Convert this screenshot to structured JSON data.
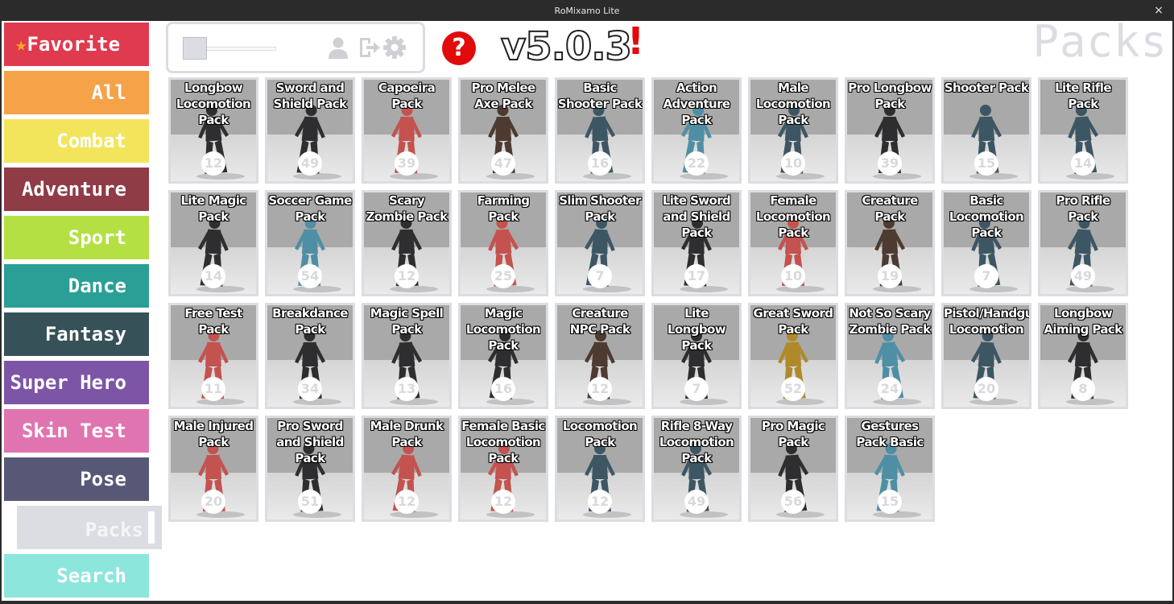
{
  "window": {
    "title": "RoMixamo Lite",
    "close_label": "×"
  },
  "categories": [
    {
      "label": "Favorite",
      "color": "#e03a4f",
      "star": "★"
    },
    {
      "label": "All",
      "color": "#f5a249"
    },
    {
      "label": "Combat",
      "color": "#f3e55b"
    },
    {
      "label": "Adventure",
      "color": "#8f3c47"
    },
    {
      "label": "Sport",
      "color": "#b4e043"
    },
    {
      "label": "Dance",
      "color": "#2a9f95"
    },
    {
      "label": "Fantasy",
      "color": "#365158"
    },
    {
      "label": "Super Hero",
      "color": "#7d55a6"
    },
    {
      "label": "Skin Test",
      "color": "#e074b0"
    },
    {
      "label": "Pose",
      "color": "#575876"
    },
    {
      "label": "Packs",
      "color": "#dcdde2",
      "selected": true
    },
    {
      "label": "Search",
      "color": "#8de6dc"
    }
  ],
  "controls": {
    "slider_value": 0.0,
    "icons": [
      "user-icon",
      "logout-icon",
      "gear-icon"
    ]
  },
  "help": {
    "label": "?"
  },
  "version": {
    "label": "v5.0.3"
  },
  "alert": {
    "label": "!"
  },
  "page_heading": "Packs",
  "colors": {
    "panel_border": "#dcdde2",
    "card_bg": "#a9a9a9",
    "help_red": "#e10b0b"
  },
  "packs": [
    {
      "title": "Longbow Locomotion Pack",
      "count": "12",
      "skin": "dark"
    },
    {
      "title": "Sword and Shield Pack",
      "count": "49",
      "skin": "dark"
    },
    {
      "title": "Capoeira Pack",
      "count": "39",
      "skin": "red"
    },
    {
      "title": "Pro Melee Axe Pack",
      "count": "47",
      "skin": "brown"
    },
    {
      "title": "Basic Shooter Pack",
      "count": "16",
      "skin": "blue"
    },
    {
      "title": "Action Adventure Pack",
      "count": "22",
      "skin": "teal"
    },
    {
      "title": "Male Locomotion Pack",
      "count": "10",
      "skin": "blue"
    },
    {
      "title": "Pro Longbow Pack",
      "count": "39",
      "skin": "dark"
    },
    {
      "title": "Shooter Pack",
      "count": "15",
      "skin": "blue"
    },
    {
      "title": "Lite Rifle Pack",
      "count": "14",
      "skin": "blue"
    },
    {
      "title": "Lite Magic Pack",
      "count": "14",
      "skin": "dark"
    },
    {
      "title": "Soccer Game Pack",
      "count": "54",
      "skin": "teal"
    },
    {
      "title": "Scary Zombie Pack",
      "count": "12",
      "skin": "dark"
    },
    {
      "title": "Farming Pack",
      "count": "25",
      "skin": "red"
    },
    {
      "title": "Slim Shooter Pack",
      "count": "7",
      "skin": "blue"
    },
    {
      "title": "Lite Sword and Shield Pack",
      "count": "17",
      "skin": "dark"
    },
    {
      "title": "Female Locomotion Pack",
      "count": "10",
      "skin": "red"
    },
    {
      "title": "Creature Pack",
      "count": "19",
      "skin": "brown"
    },
    {
      "title": "Basic Locomotion Pack",
      "count": "7",
      "skin": "blue"
    },
    {
      "title": "Pro Rifle Pack",
      "count": "49",
      "skin": "blue"
    },
    {
      "title": "Free Test Pack",
      "count": "11",
      "skin": "red"
    },
    {
      "title": "Breakdance Pack",
      "count": "34",
      "skin": "dark"
    },
    {
      "title": "Magic Spell Pack",
      "count": "13",
      "skin": "dark"
    },
    {
      "title": "Magic Locomotion Pack",
      "count": "16",
      "skin": "dark"
    },
    {
      "title": "Creature NPC Pack",
      "count": "12",
      "skin": "brown"
    },
    {
      "title": "Lite Longbow Pack",
      "count": "7",
      "skin": "dark"
    },
    {
      "title": "Great Sword Pack",
      "count": "52",
      "skin": "gold"
    },
    {
      "title": "Not So Scary Zombie Pack",
      "count": "24",
      "skin": "teal"
    },
    {
      "title": "Pistol/Handgun Locomotion",
      "count": "20",
      "skin": "blue"
    },
    {
      "title": "Longbow Aiming Pack",
      "count": "8",
      "skin": "dark"
    },
    {
      "title": "Male Injured Pack",
      "count": "20",
      "skin": "red"
    },
    {
      "title": "Pro Sword and Shield Pack",
      "count": "51",
      "skin": "dark"
    },
    {
      "title": "Male Drunk Pack",
      "count": "12",
      "skin": "red"
    },
    {
      "title": "Female Basic Locomotion Pack",
      "count": "12",
      "skin": "red"
    },
    {
      "title": "Locomotion Pack",
      "count": "12",
      "skin": "blue"
    },
    {
      "title": "Rifle 8-Way Locomotion Pack",
      "count": "49",
      "skin": "blue"
    },
    {
      "title": "Pro Magic Pack",
      "count": "56",
      "skin": "dark"
    },
    {
      "title": "Gestures Pack Basic",
      "count": "15",
      "skin": "teal"
    }
  ],
  "skins": {
    "dark": "#2e2e30",
    "red": "#c4524f",
    "blue": "#3d5664",
    "teal": "#4e8fa5",
    "brown": "#4d3a30",
    "gold": "#b08a2a"
  }
}
